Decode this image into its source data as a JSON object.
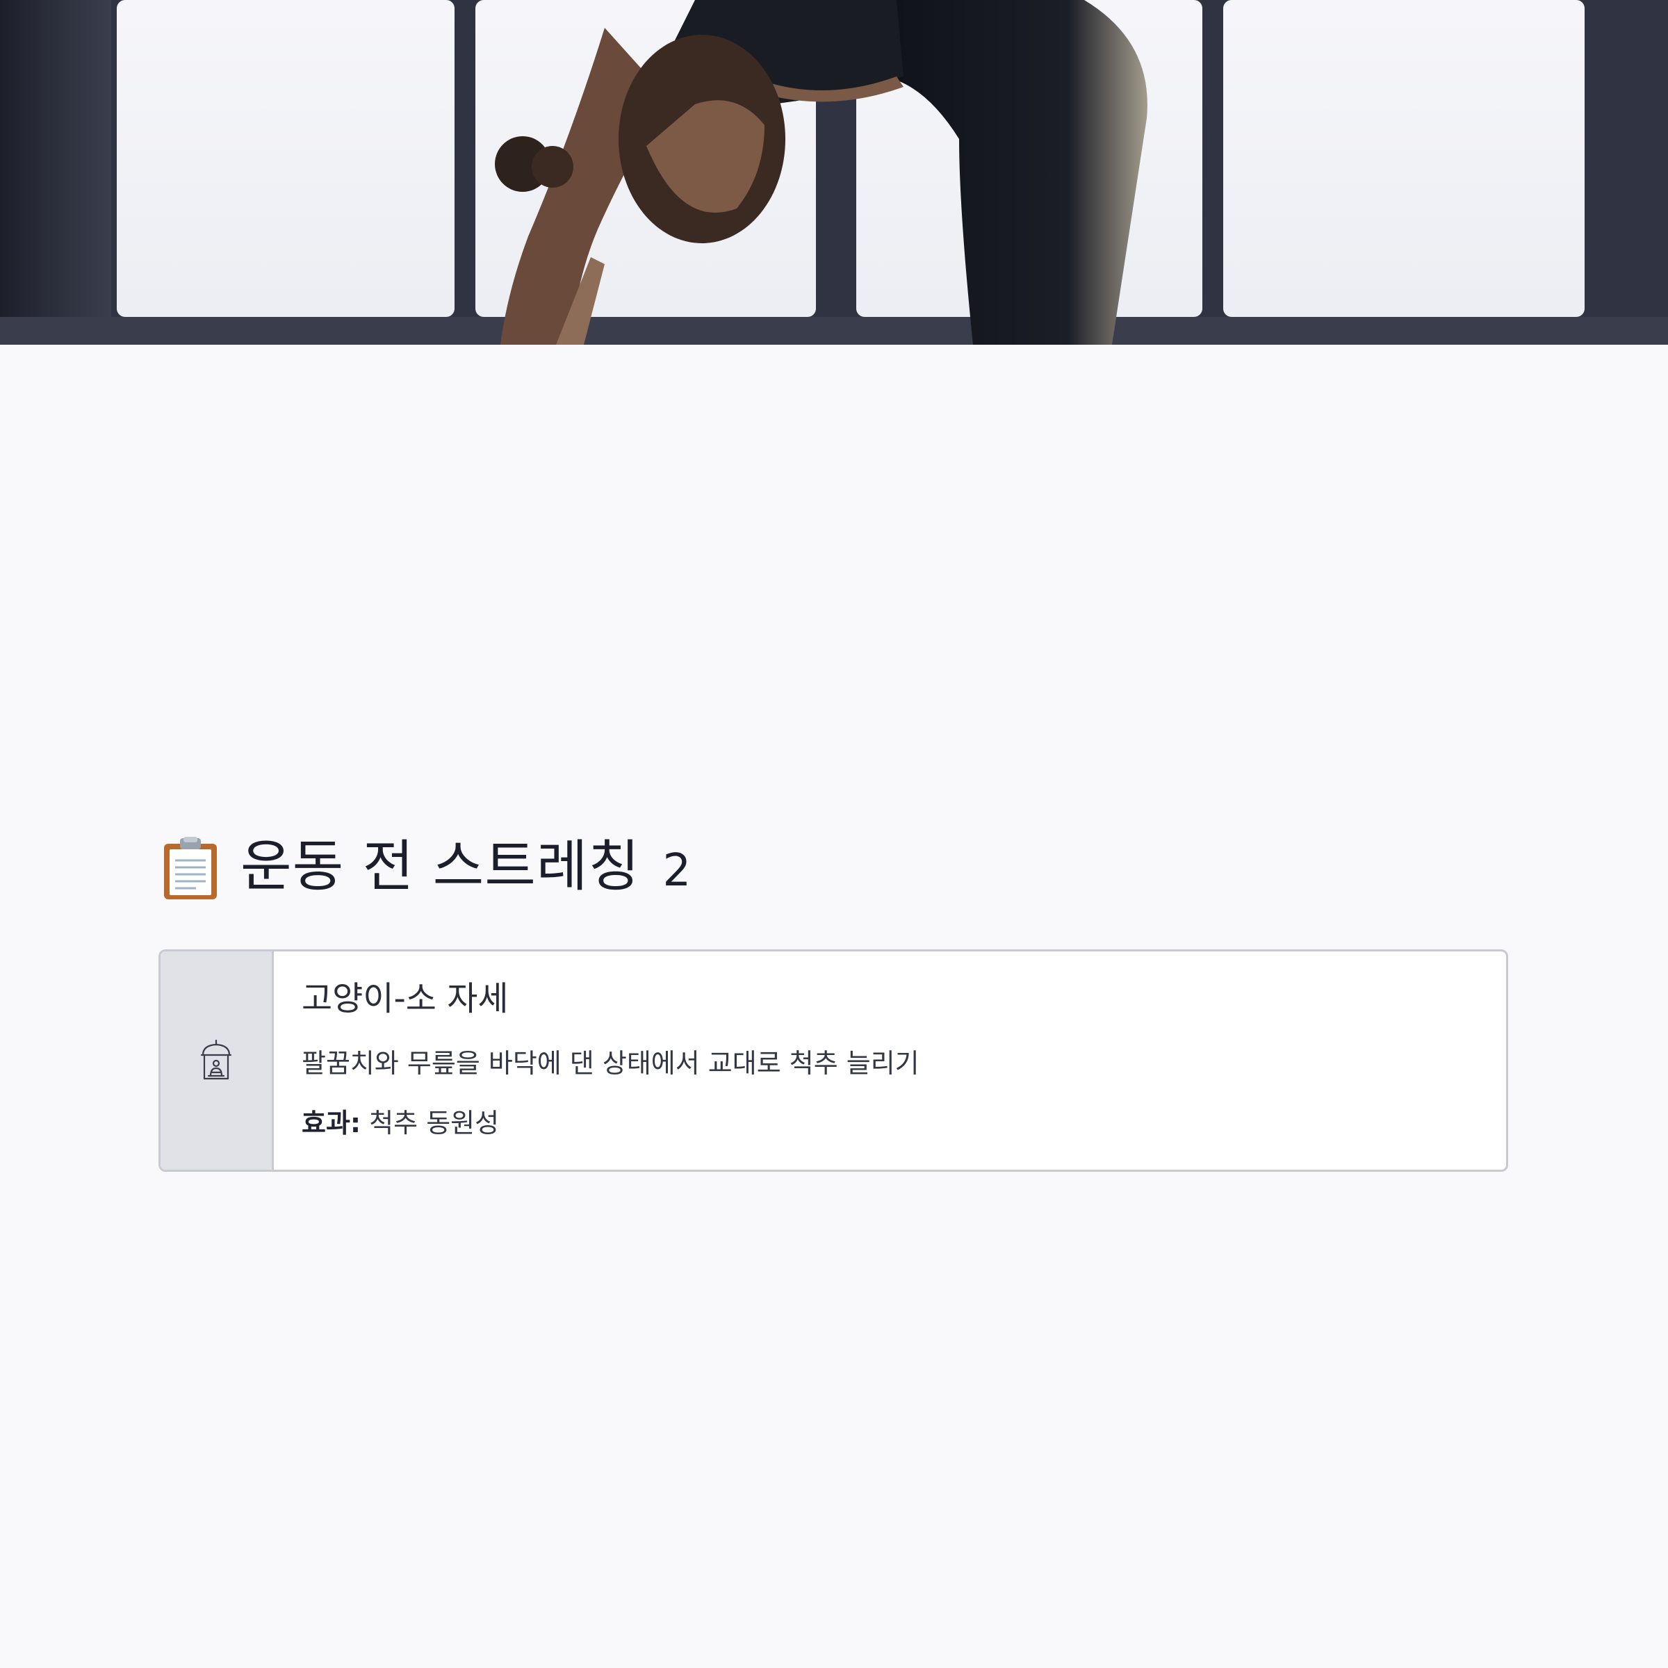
{
  "hero": {
    "image_alt": "",
    "icon": "hero-photo"
  },
  "heading": {
    "icon": "clipboard-icon",
    "title": "운동 전 스트레칭",
    "number": "2"
  },
  "card": {
    "icon": "yoga-meditation-icon",
    "title": "고양이-소 자세",
    "description": "팔꿈치와 무릎을 바닥에 댄 상태에서 교대로 척추 늘리기",
    "effect_label": "효과:",
    "effect_value": "척추 동원성"
  },
  "colors": {
    "page_background": "#f9f9fb",
    "card_border": "#c8c9d1",
    "card_side": "#e1e2e8",
    "text": "#1c1f2b"
  }
}
